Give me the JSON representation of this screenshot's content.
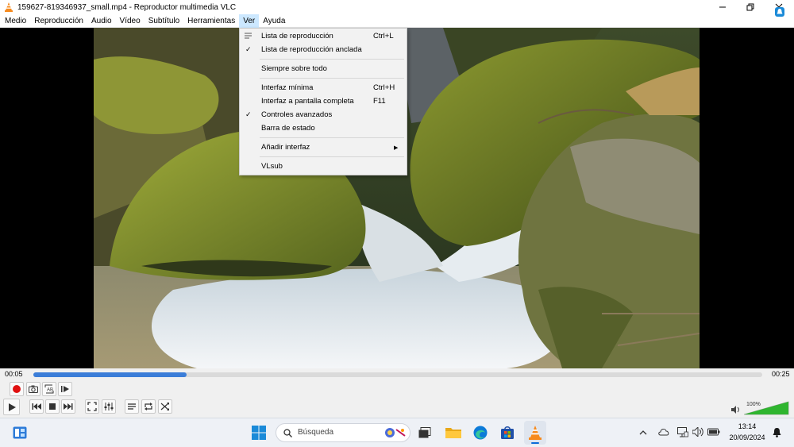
{
  "window": {
    "title": "159627-819346937_small.mp4 - Reproductor multimedia VLC"
  },
  "menubar": {
    "items": [
      "Medio",
      "Reproducción",
      "Audio",
      "Vídeo",
      "Subtítulo",
      "Herramientas",
      "Ver",
      "Ayuda"
    ]
  },
  "view_menu": {
    "items": [
      {
        "label": "Lista de reproducción",
        "shortcut": "Ctrl+L",
        "checked": false
      },
      {
        "label": "Lista de reproducción anclada",
        "shortcut": "",
        "checked": true
      },
      {
        "label": "Siempre sobre todo",
        "shortcut": "",
        "checked": false
      },
      {
        "label": "Interfaz mínima",
        "shortcut": "Ctrl+H",
        "checked": false
      },
      {
        "label": "Interfaz a pantalla completa",
        "shortcut": "F11",
        "checked": false
      },
      {
        "label": "Controles avanzados",
        "shortcut": "",
        "checked": true
      },
      {
        "label": "Barra de estado",
        "shortcut": "",
        "checked": false
      },
      {
        "label": "Añadir interfaz",
        "shortcut": "",
        "checked": false,
        "submenu": true
      },
      {
        "label": "VLsub",
        "shortcut": "",
        "checked": false
      }
    ]
  },
  "playback": {
    "elapsed": "00:05",
    "total": "00:25",
    "progress": 0.21,
    "volume_label": "100%",
    "volume": 1.0
  },
  "taskbar": {
    "search_placeholder": "Búsqueda",
    "time": "13:14",
    "date": "20/09/2024"
  },
  "colors": {
    "accent": "#3b7dd8",
    "menu_highlight": "#cce8ff",
    "volume_green": "#2fb52f",
    "record_red": "#e01010"
  }
}
